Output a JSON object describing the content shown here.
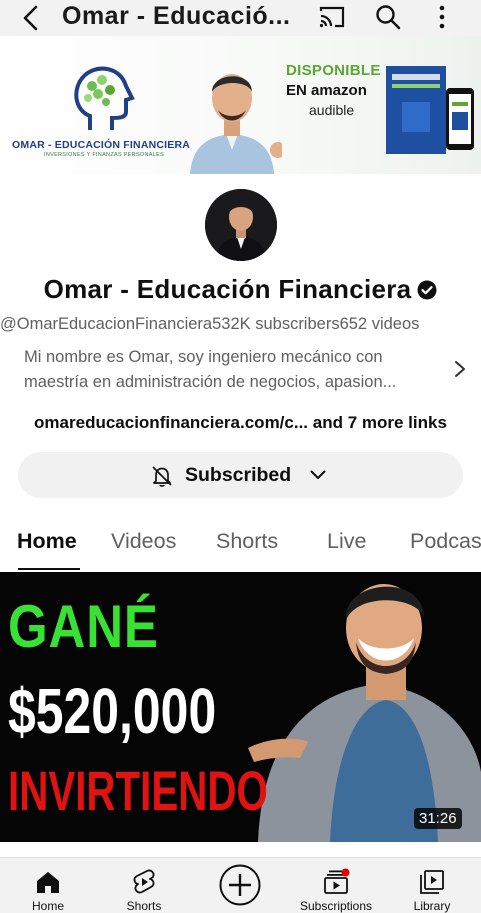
{
  "topbar": {
    "title": "Omar - Educació...",
    "back_icon": "back-arrow-icon",
    "cast_icon": "cast-icon",
    "search_icon": "search-icon",
    "more_icon": "more-vertical-icon"
  },
  "banner": {
    "brand": "OMAR - EDUCACIÓN FINANCIERA",
    "brand_sub": "INVERSIONES Y FINANZAS PERSONALES",
    "available": "DISPONIBLE",
    "store": "EN amazon",
    "audible": "audible"
  },
  "channel": {
    "name": "Omar - Educación Financiera",
    "handle": "@OmarEducacionFinanciera",
    "subscribers": "532K subscribers",
    "videos": "652 videos",
    "description": "Mi nombre es Omar, soy ingeniero mecánico con maestría en administración de negocios, apasion...",
    "link": "omareducacionfinanciera.com/c...",
    "more_links": "and 7 more links"
  },
  "subscribe": {
    "label": "Subscribed"
  },
  "tabs": [
    {
      "label": "Home",
      "active": true
    },
    {
      "label": "Videos"
    },
    {
      "label": "Shorts"
    },
    {
      "label": "Live"
    },
    {
      "label": "Podcas"
    }
  ],
  "video": {
    "line1": "GANÉ",
    "line2": "$520,000",
    "line3": "INVIRTIENDO",
    "duration": "31:26"
  },
  "bottom_nav": [
    {
      "label": "Home",
      "icon": "home-icon"
    },
    {
      "label": "Shorts",
      "icon": "shorts-icon"
    },
    {
      "label": "",
      "icon": "create-plus-icon"
    },
    {
      "label": "Subscriptions",
      "icon": "subscriptions-icon"
    },
    {
      "label": "Library",
      "icon": "library-icon"
    }
  ],
  "colors": {
    "accent_green": "#39e135",
    "accent_red": "#e01212",
    "text_primary": "#0f0f0f",
    "text_secondary": "#606060",
    "notification_dot": "#e00000"
  }
}
